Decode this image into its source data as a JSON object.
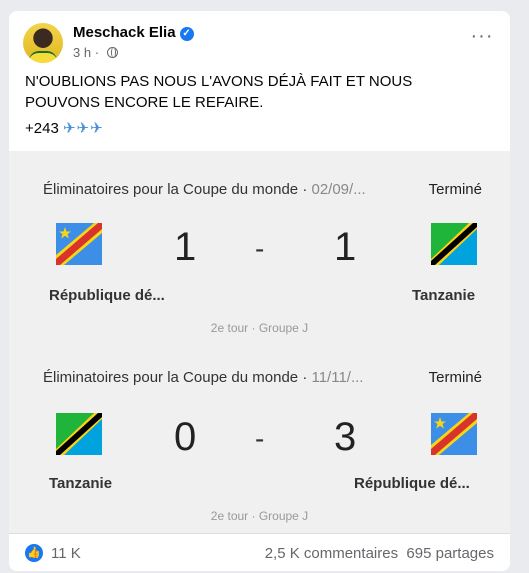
{
  "post": {
    "author": "Meschack Elia",
    "time": "3 h",
    "text": "N'OUBLIONS PAS NOUS L'AVONS DÉJÀ FAIT ET NOUS POUVONS ENCORE LE REFAIRE.",
    "tag": "+243",
    "planes": "✈✈✈"
  },
  "matches": [
    {
      "title": "Éliminatoires pour la Coupe du monde · ",
      "date": "02/09/...",
      "status": "Terminé",
      "home_team": "République dé...",
      "away_team": "Tanzanie",
      "home_score": "1",
      "away_score": "1",
      "separator": "-",
      "round": "2e tour · Groupe J",
      "home_flag": "drc-flag-icon",
      "away_flag": "tanzania-flag-icon"
    },
    {
      "title": "Éliminatoires pour la Coupe du monde · ",
      "date": "11/11/...",
      "status": "Terminé",
      "home_team": "Tanzanie",
      "away_team": "République dé...",
      "home_score": "0",
      "away_score": "3",
      "separator": "-",
      "round": "2e tour · Groupe J",
      "home_flag": "tanzania-flag-icon",
      "away_flag": "drc-flag-icon"
    }
  ],
  "footer": {
    "likes": "11 K",
    "comments": "2,5 K commentaires",
    "shares": "695 partages"
  },
  "colors": {
    "accent": "#1877f2",
    "drc_blue": "#3d8ee6",
    "drc_red": "#d9342b",
    "drc_yellow": "#f7d618",
    "tz_green": "#1eb53a",
    "tz_blue": "#00a3dd"
  }
}
